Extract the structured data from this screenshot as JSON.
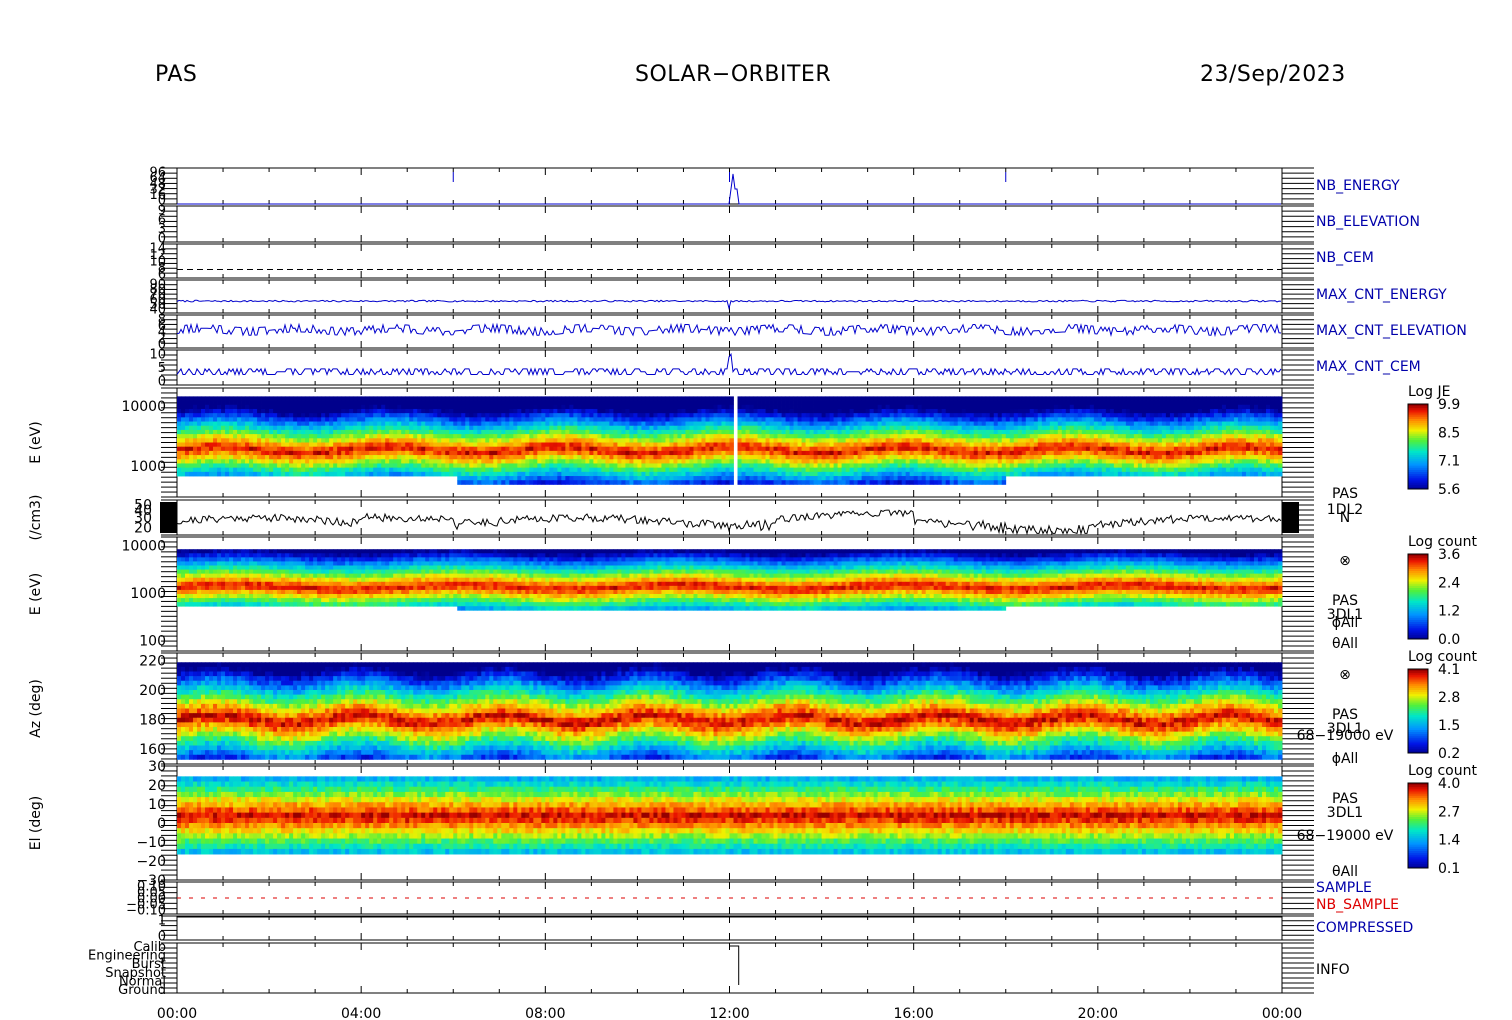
{
  "header": {
    "instrument": "PAS",
    "mission": "SOLAR−ORBITER",
    "date": "23/Sep/2023"
  },
  "colors": {
    "line_blue": "#0000cc",
    "text_blue": "#0000aa",
    "nb_sample_red": "#dd0000",
    "axis": "#000000"
  },
  "chart_data": [
    {
      "type": "line",
      "id": "nb_energy",
      "label": "NB_ENERGY",
      "y_ticks": [
        "96",
        "64",
        "48",
        "32",
        "16",
        "0"
      ],
      "ylim": [
        0,
        96
      ],
      "note": "value near 0 with brief spikes at ~06:00, 12:00 (step), 18:00"
    },
    {
      "type": "line",
      "id": "nb_elevation",
      "label": "NB_ELEVATION",
      "y_ticks": [
        "9",
        "6",
        "3",
        "0"
      ],
      "ylim": [
        0,
        9
      ]
    },
    {
      "type": "line",
      "id": "nb_cem",
      "label": "NB_CEM",
      "y_ticks": [
        "14",
        "12",
        "10",
        "8",
        "6"
      ],
      "ylim": [
        6,
        14
      ],
      "value": 8
    },
    {
      "type": "line",
      "id": "max_cnt_energy",
      "label": "MAX_CNT_ENERGY",
      "y_ticks": [
        "90",
        "80",
        "70",
        "60",
        "50",
        "40"
      ],
      "ylim": [
        40,
        90
      ],
      "typical_value": 58
    },
    {
      "type": "line",
      "id": "max_cnt_elevation",
      "label": "MAX_CNT_ELEVATION",
      "y_ticks": [
        "8",
        "6",
        "4",
        "2",
        "0"
      ],
      "ylim": [
        0,
        8
      ],
      "typical_range": [
        3,
        6
      ]
    },
    {
      "type": "line",
      "id": "max_cnt_cem",
      "label": "MAX_CNT_CEM",
      "y_ticks": [
        "10",
        "5",
        "0"
      ],
      "ylim": [
        0,
        10
      ],
      "typical_range": [
        2,
        5
      ]
    },
    {
      "type": "heatmap",
      "id": "je_spectrogram",
      "ylabel": "E (eV)",
      "yscale": "log",
      "y_ticks": [
        "10000",
        "1000"
      ],
      "ylim": [
        300,
        20000
      ],
      "colorbar": {
        "title": "Log JE",
        "ticks": [
          "9.9",
          "8.5",
          "7.1",
          "5.6"
        ],
        "range": [
          5.6,
          9.9
        ]
      },
      "peak_energy_eV": 1500
    },
    {
      "type": "line",
      "id": "density",
      "ylabel": "(/cm3)",
      "yscale": "log",
      "y_ticks": [
        "50",
        "40",
        "30",
        "20"
      ],
      "ylim": [
        15,
        60
      ],
      "side_label": [
        "PAS",
        "1DL2",
        "N"
      ],
      "typical_value": 27
    },
    {
      "type": "heatmap",
      "id": "count_spectrogram",
      "ylabel": "E (eV)",
      "yscale": "log",
      "y_ticks": [
        "10000",
        "1000",
        "100"
      ],
      "ylim": [
        60,
        15000
      ],
      "colorbar": {
        "title": "Log count",
        "ticks": [
          "3.6",
          "2.4",
          "1.2",
          "0.0"
        ],
        "range": [
          0.0,
          3.6
        ]
      },
      "side_label": [
        "⊗",
        "PAS",
        "3DL1",
        "ϕAll",
        "θAll"
      ]
    },
    {
      "type": "heatmap",
      "id": "azimuth",
      "ylabel": "Az (deg)",
      "y_ticks": [
        "220",
        "200",
        "180",
        "160"
      ],
      "ylim": [
        150,
        225
      ],
      "colorbar": {
        "title": "Log count",
        "ticks": [
          "4.1",
          "2.8",
          "1.5",
          "0.2"
        ],
        "range": [
          0.2,
          4.1
        ]
      },
      "side_label": [
        "⊗",
        "PAS",
        "3DL1",
        "68−19000 eV",
        "ϕAll"
      ]
    },
    {
      "type": "heatmap",
      "id": "elevation",
      "ylabel": "El (deg)",
      "y_ticks": [
        "30",
        "20",
        "10",
        "0",
        "−10",
        "−20",
        "−30"
      ],
      "ylim": [
        -30,
        30
      ],
      "colorbar": {
        "title": "Log count",
        "ticks": [
          "4.0",
          "2.7",
          "1.4",
          "0.1"
        ],
        "range": [
          0.1,
          4.0
        ]
      },
      "side_label": [
        "PAS",
        "3DL1",
        "68−19000 eV",
        "θAll"
      ]
    },
    {
      "type": "line",
      "id": "sample",
      "labels": [
        "SAMPLE",
        "NB_SAMPLE"
      ],
      "y_ticks": [
        "0.10",
        "0.05",
        "0.00",
        "−0.05",
        "−0.10"
      ],
      "ylim": [
        -0.1,
        0.1
      ],
      "value": 0
    },
    {
      "type": "line",
      "id": "compressed",
      "label": "COMPRESSED",
      "y_ticks": [
        "1",
        "0"
      ],
      "ylim": [
        0,
        1
      ],
      "value": 1
    },
    {
      "type": "line",
      "id": "info",
      "label": "INFO",
      "categories": [
        "Calib",
        "Engineering",
        "Burst",
        "Snapshot",
        "Normal",
        "Ground"
      ],
      "note": "Normal mode throughout with Calib step near 12:00"
    }
  ],
  "x_axis": {
    "ticks": [
      "00:00",
      "04:00",
      "08:00",
      "12:00",
      "16:00",
      "20:00",
      "00:00"
    ],
    "range_hours": [
      0,
      24
    ]
  }
}
